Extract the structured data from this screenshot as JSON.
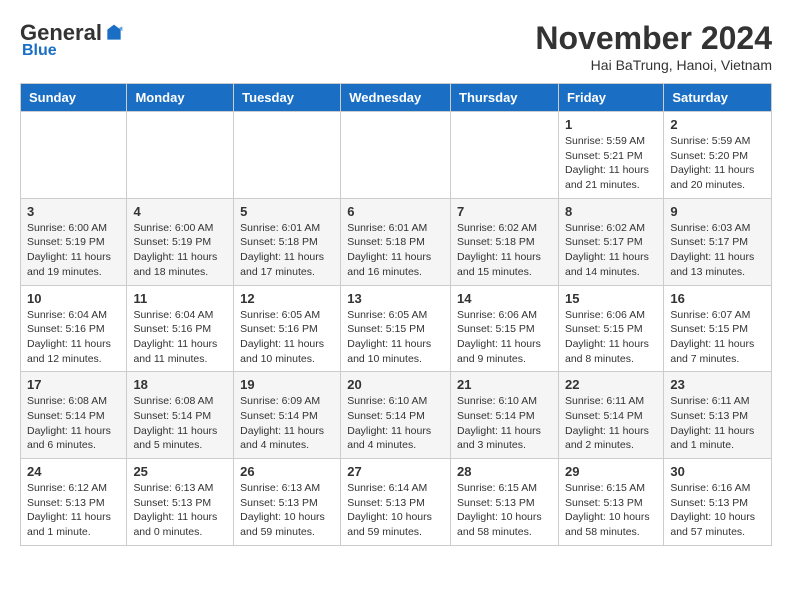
{
  "logo": {
    "general": "General",
    "blue": "Blue"
  },
  "title": "November 2024",
  "subtitle": "Hai BaTrung, Hanoi, Vietnam",
  "headers": [
    "Sunday",
    "Monday",
    "Tuesday",
    "Wednesday",
    "Thursday",
    "Friday",
    "Saturday"
  ],
  "weeks": [
    [
      {
        "day": "",
        "text": ""
      },
      {
        "day": "",
        "text": ""
      },
      {
        "day": "",
        "text": ""
      },
      {
        "day": "",
        "text": ""
      },
      {
        "day": "",
        "text": ""
      },
      {
        "day": "1",
        "text": "Sunrise: 5:59 AM\nSunset: 5:21 PM\nDaylight: 11 hours and 21 minutes."
      },
      {
        "day": "2",
        "text": "Sunrise: 5:59 AM\nSunset: 5:20 PM\nDaylight: 11 hours and 20 minutes."
      }
    ],
    [
      {
        "day": "3",
        "text": "Sunrise: 6:00 AM\nSunset: 5:19 PM\nDaylight: 11 hours and 19 minutes."
      },
      {
        "day": "4",
        "text": "Sunrise: 6:00 AM\nSunset: 5:19 PM\nDaylight: 11 hours and 18 minutes."
      },
      {
        "day": "5",
        "text": "Sunrise: 6:01 AM\nSunset: 5:18 PM\nDaylight: 11 hours and 17 minutes."
      },
      {
        "day": "6",
        "text": "Sunrise: 6:01 AM\nSunset: 5:18 PM\nDaylight: 11 hours and 16 minutes."
      },
      {
        "day": "7",
        "text": "Sunrise: 6:02 AM\nSunset: 5:18 PM\nDaylight: 11 hours and 15 minutes."
      },
      {
        "day": "8",
        "text": "Sunrise: 6:02 AM\nSunset: 5:17 PM\nDaylight: 11 hours and 14 minutes."
      },
      {
        "day": "9",
        "text": "Sunrise: 6:03 AM\nSunset: 5:17 PM\nDaylight: 11 hours and 13 minutes."
      }
    ],
    [
      {
        "day": "10",
        "text": "Sunrise: 6:04 AM\nSunset: 5:16 PM\nDaylight: 11 hours and 12 minutes."
      },
      {
        "day": "11",
        "text": "Sunrise: 6:04 AM\nSunset: 5:16 PM\nDaylight: 11 hours and 11 minutes."
      },
      {
        "day": "12",
        "text": "Sunrise: 6:05 AM\nSunset: 5:16 PM\nDaylight: 11 hours and 10 minutes."
      },
      {
        "day": "13",
        "text": "Sunrise: 6:05 AM\nSunset: 5:15 PM\nDaylight: 11 hours and 10 minutes."
      },
      {
        "day": "14",
        "text": "Sunrise: 6:06 AM\nSunset: 5:15 PM\nDaylight: 11 hours and 9 minutes."
      },
      {
        "day": "15",
        "text": "Sunrise: 6:06 AM\nSunset: 5:15 PM\nDaylight: 11 hours and 8 minutes."
      },
      {
        "day": "16",
        "text": "Sunrise: 6:07 AM\nSunset: 5:15 PM\nDaylight: 11 hours and 7 minutes."
      }
    ],
    [
      {
        "day": "17",
        "text": "Sunrise: 6:08 AM\nSunset: 5:14 PM\nDaylight: 11 hours and 6 minutes."
      },
      {
        "day": "18",
        "text": "Sunrise: 6:08 AM\nSunset: 5:14 PM\nDaylight: 11 hours and 5 minutes."
      },
      {
        "day": "19",
        "text": "Sunrise: 6:09 AM\nSunset: 5:14 PM\nDaylight: 11 hours and 4 minutes."
      },
      {
        "day": "20",
        "text": "Sunrise: 6:10 AM\nSunset: 5:14 PM\nDaylight: 11 hours and 4 minutes."
      },
      {
        "day": "21",
        "text": "Sunrise: 6:10 AM\nSunset: 5:14 PM\nDaylight: 11 hours and 3 minutes."
      },
      {
        "day": "22",
        "text": "Sunrise: 6:11 AM\nSunset: 5:14 PM\nDaylight: 11 hours and 2 minutes."
      },
      {
        "day": "23",
        "text": "Sunrise: 6:11 AM\nSunset: 5:13 PM\nDaylight: 11 hours and 1 minute."
      }
    ],
    [
      {
        "day": "24",
        "text": "Sunrise: 6:12 AM\nSunset: 5:13 PM\nDaylight: 11 hours and 1 minute."
      },
      {
        "day": "25",
        "text": "Sunrise: 6:13 AM\nSunset: 5:13 PM\nDaylight: 11 hours and 0 minutes."
      },
      {
        "day": "26",
        "text": "Sunrise: 6:13 AM\nSunset: 5:13 PM\nDaylight: 10 hours and 59 minutes."
      },
      {
        "day": "27",
        "text": "Sunrise: 6:14 AM\nSunset: 5:13 PM\nDaylight: 10 hours and 59 minutes."
      },
      {
        "day": "28",
        "text": "Sunrise: 6:15 AM\nSunset: 5:13 PM\nDaylight: 10 hours and 58 minutes."
      },
      {
        "day": "29",
        "text": "Sunrise: 6:15 AM\nSunset: 5:13 PM\nDaylight: 10 hours and 58 minutes."
      },
      {
        "day": "30",
        "text": "Sunrise: 6:16 AM\nSunset: 5:13 PM\nDaylight: 10 hours and 57 minutes."
      }
    ]
  ]
}
